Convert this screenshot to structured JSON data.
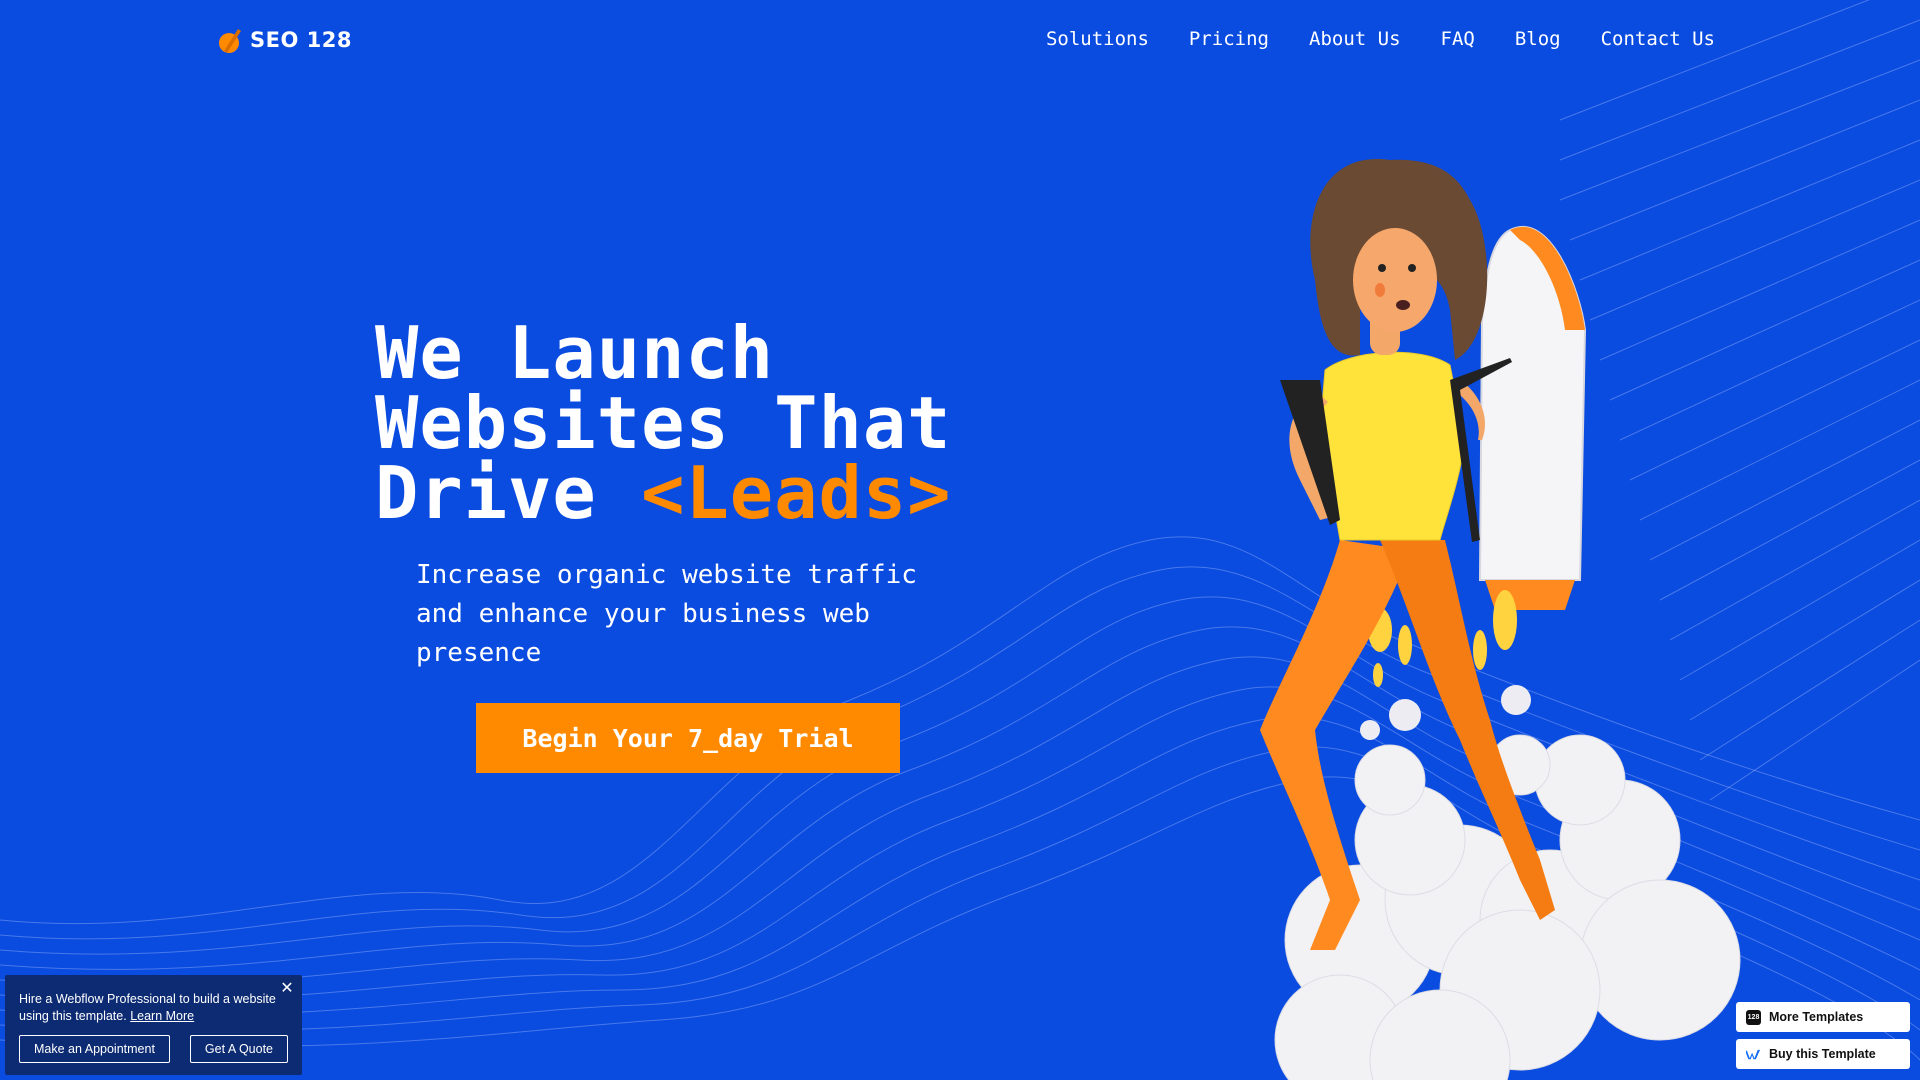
{
  "header": {
    "logo_text": "SEO 128",
    "nav": [
      "Solutions",
      "Pricing",
      "About Us",
      "FAQ",
      "Blog",
      "Contact Us"
    ]
  },
  "hero": {
    "headline_line1": "We Launch",
    "headline_line2": "Websites That",
    "headline_line3_plain": "Drive ",
    "headline_line3_accent": "<Leads>",
    "subtext": "Increase organic website traffic and enhance your business web presence",
    "cta_label": "Begin Your 7_day Trial"
  },
  "hire_popup": {
    "text": "Hire a Webflow Professional to build a website using this template.",
    "link": "Learn More",
    "appointment_label": "Make an Appointment",
    "quote_label": "Get A Quote"
  },
  "badges": {
    "more_templates": "More Templates",
    "buy_template": "Buy this Template",
    "more_icon_text": "128"
  },
  "colors": {
    "background": "#0a4be0",
    "accent": "#ff8a00",
    "popup_bg": "#0c2b73",
    "text": "#ffffff"
  },
  "icons": {
    "logo": "seo128-logo-icon",
    "close": "close-icon",
    "webflow": "webflow-icon"
  }
}
